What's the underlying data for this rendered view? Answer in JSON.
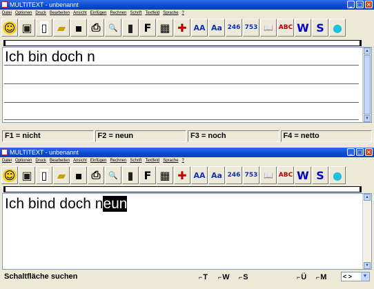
{
  "window1": {
    "title": "MULTITEXT  -  unbenannt",
    "menu": [
      "Datei",
      "Optionen",
      "Druck",
      "Bearbeiten",
      "Ansicht",
      "Einfügen",
      "Rechnen",
      "Schrift",
      "Textfeld",
      "Sprache",
      "?"
    ],
    "text": "Ich bin doch n",
    "fkeys": [
      "F1 = nicht",
      "F2 = neun",
      "F3 = noch",
      "F4 = netto"
    ]
  },
  "window2": {
    "title": "MULTITEXT  -  unbenannt",
    "menu": [
      "Datei",
      "Optionen",
      "Druck",
      "Bearbeiten",
      "Ansicht",
      "Einfügen",
      "Rechnen",
      "Schrift",
      "Textfeld",
      "Sprache",
      "?"
    ],
    "text_typed": "Ich bind doch n",
    "text_suggestion": "eun",
    "status": "Schaltfläche suchen",
    "options": [
      "T",
      "W",
      "S",
      "Ü",
      "M"
    ],
    "combo_value": "< >"
  },
  "toolbar": [
    {
      "name": "smiley-icon",
      "glyph": "☺",
      "color": "#000000",
      "bg": "#f7d117"
    },
    {
      "name": "picture-icon",
      "glyph": "▣",
      "color": "#202020",
      "bg": "#ece9d8"
    },
    {
      "name": "new-document-icon",
      "glyph": "▯",
      "color": "#000000",
      "bg": "#ffffff"
    },
    {
      "name": "open-folder-icon",
      "glyph": "▰",
      "color": "#c8a000",
      "bg": "#ece9d8"
    },
    {
      "name": "save-icon",
      "glyph": "▪",
      "color": "#000000",
      "bg": "#ece9d8"
    },
    {
      "name": "print-icon",
      "glyph": "⎙",
      "color": "#000000",
      "bg": "#ece9d8"
    },
    {
      "name": "print-preview-icon",
      "glyph": "🔍",
      "color": "#000000",
      "bg": "#ece9d8"
    },
    {
      "name": "trash-icon",
      "glyph": "▮",
      "color": "#202020",
      "bg": "#ece9d8"
    },
    {
      "name": "font-icon",
      "glyph": "F",
      "color": "#000000",
      "bg": "#ece9d8"
    },
    {
      "name": "calculator-icon",
      "glyph": "▦",
      "color": "#000000",
      "bg": "#ece9d8"
    },
    {
      "name": "table-icon",
      "glyph": "✚",
      "color": "#c00000",
      "bg": "#ece9d8"
    },
    {
      "name": "text-size-icon",
      "glyph": "AA",
      "color": "#1030c0",
      "bg": "#ece9d8"
    },
    {
      "name": "font-style-icon",
      "glyph": "Aa",
      "color": "#1030c0",
      "bg": "#ece9d8"
    },
    {
      "name": "numbers-icon",
      "glyph": "246",
      "color": "#1030c0",
      "bg": "#ece9d8"
    },
    {
      "name": "numbers-alt-icon",
      "glyph": "753",
      "color": "#1030c0",
      "bg": "#ece9d8"
    },
    {
      "name": "dictionary-icon",
      "glyph": "📖",
      "color": "#000000",
      "bg": "#ece9d8"
    },
    {
      "name": "spellcheck-icon",
      "glyph": "ABC",
      "color": "#c00000",
      "bg": "#ece9d8"
    },
    {
      "name": "word-w-icon",
      "glyph": "W",
      "color": "#0000c0",
      "bg": "#ece9d8"
    },
    {
      "name": "speech-s-icon",
      "glyph": "S",
      "color": "#0000c0",
      "bg": "#ece9d8"
    },
    {
      "name": "speech-bubble-icon",
      "glyph": "●",
      "color": "#20c0e0",
      "bg": "#ece9d8"
    }
  ]
}
